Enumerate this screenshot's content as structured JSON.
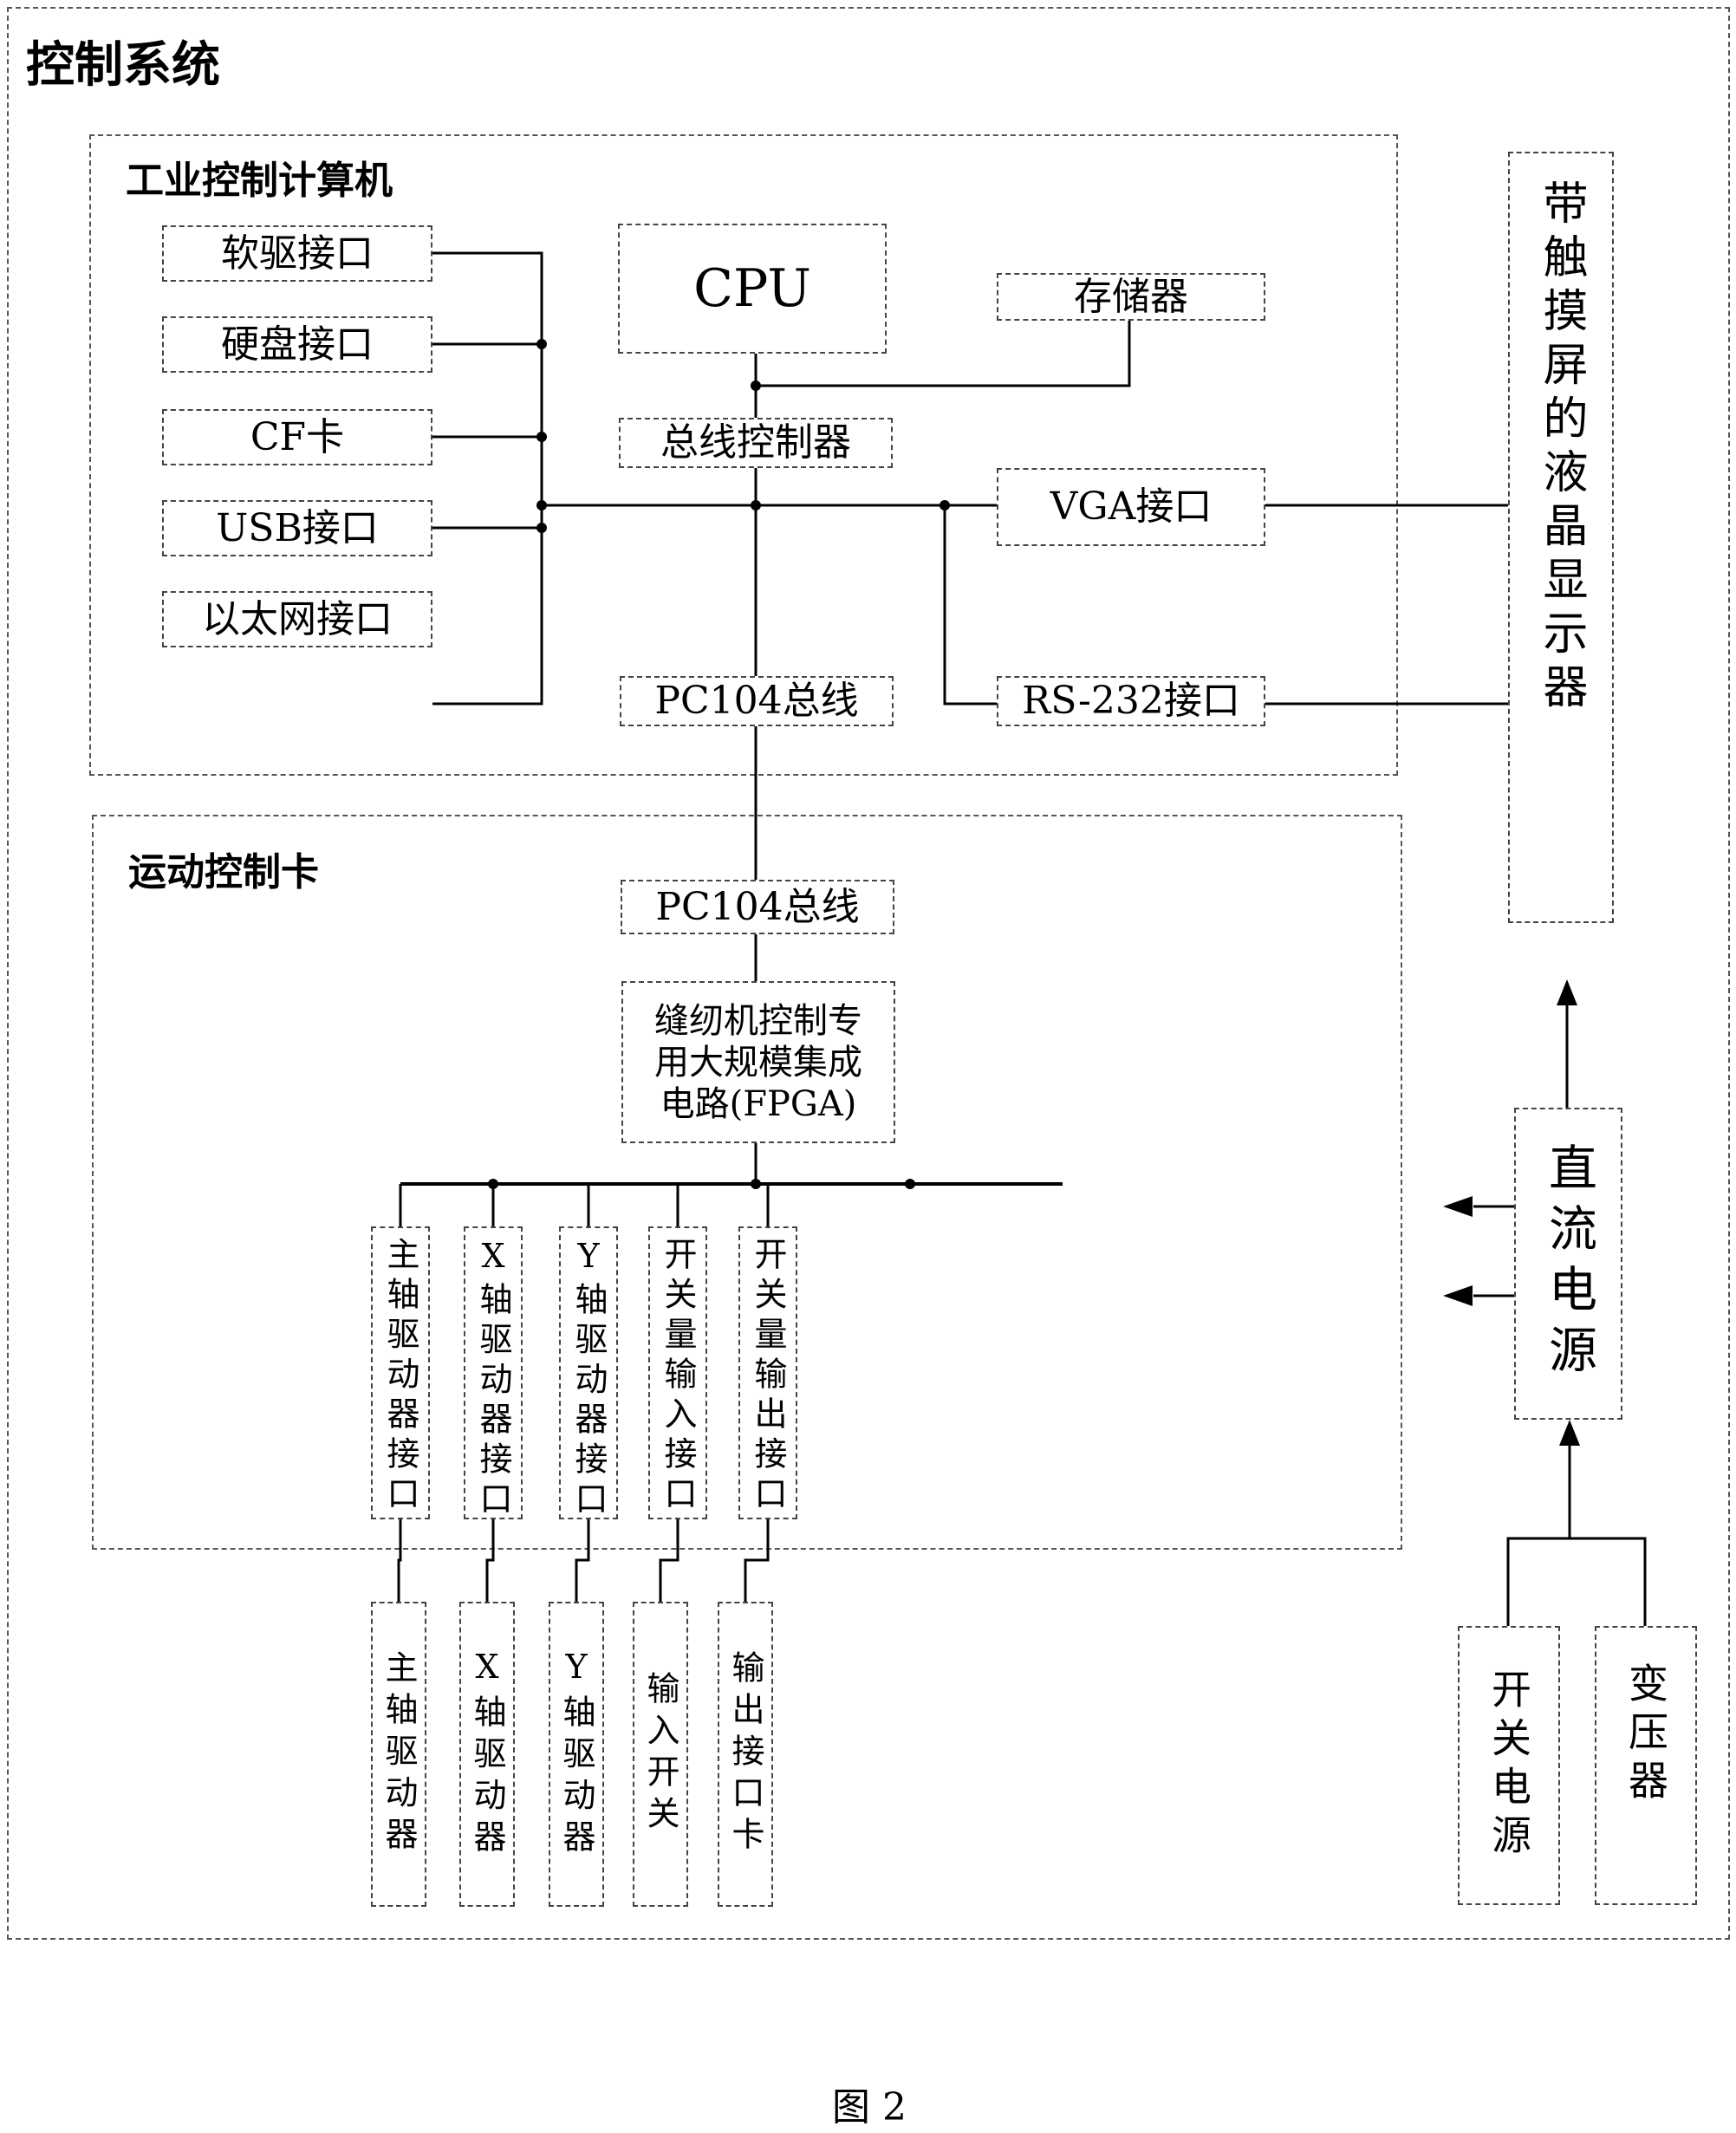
{
  "title": "控制系统",
  "figure_caption": "图 2",
  "industrial_pc": {
    "title": "工业控制计算机",
    "left_interfaces": [
      "软驱接口",
      "硬盘接口",
      "CF卡",
      "USB接口",
      "以太网接口"
    ],
    "cpu": "CPU",
    "memory": "存储器",
    "bus_controller": "总线控制器",
    "pc104_bus": "PC104总线",
    "vga": "VGA接口",
    "rs232": "RS-232接口"
  },
  "display": {
    "label": "带触摸屏的液晶显示器"
  },
  "motion_card": {
    "title": "运动控制卡",
    "pc104_bus": "PC104总线",
    "fpga_lines": [
      "缝纫机控制专",
      "用大规模集成",
      "电路(FPGA)"
    ],
    "interfaces": [
      "主轴驱动器接口",
      "X轴驱动器接口",
      "Y轴驱动器接口",
      "开关量输入接口",
      "开关量输出接口"
    ]
  },
  "external_devices": [
    "主轴驱动器",
    "X轴驱动器",
    "Y轴驱动器",
    "输入开关",
    "输出接口卡"
  ],
  "power": {
    "dc_supply": "直流电源",
    "switching_supply": "开关电源",
    "transformer": "变压器"
  }
}
